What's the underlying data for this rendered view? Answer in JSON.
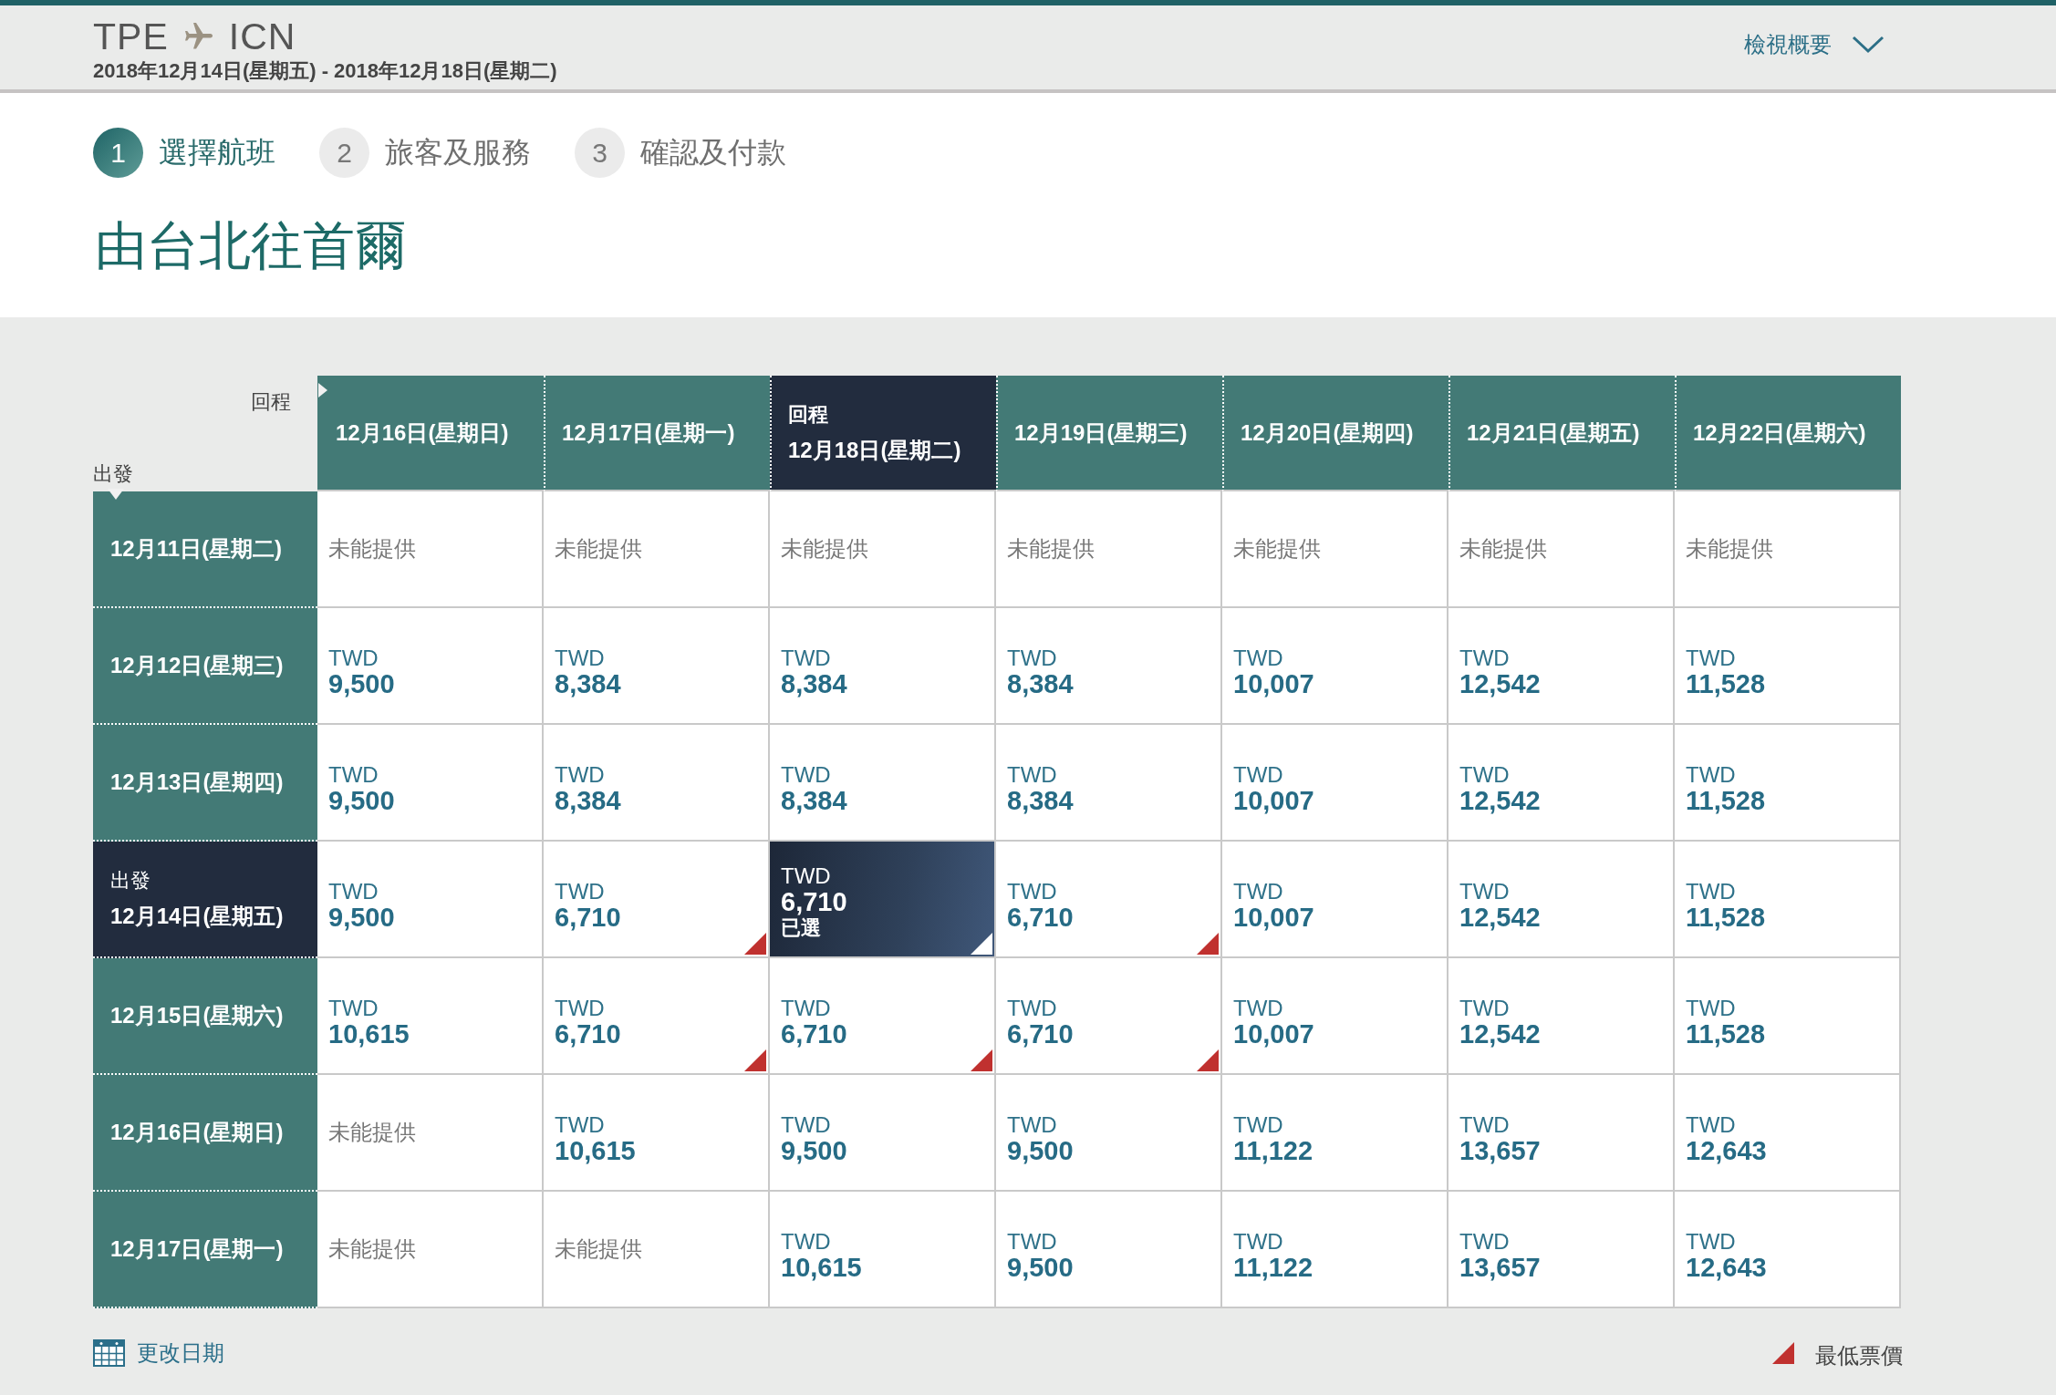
{
  "header": {
    "origin": "TPE",
    "destination": "ICN",
    "dates": "2018年12月14日(星期五) - 2018年12月18日(星期二)",
    "summary_link": "檢視概要"
  },
  "steps": [
    {
      "number": "1",
      "label": "選擇航班",
      "selected": true
    },
    {
      "number": "2",
      "label": "旅客及服務",
      "selected": false
    },
    {
      "number": "3",
      "label": "確認及付款",
      "selected": false
    }
  ],
  "title": "由台北往首爾",
  "fare_grid": {
    "return_label": "回程",
    "depart_label": "出發",
    "columns": [
      {
        "date": "12月16日(星期日)",
        "selected": false
      },
      {
        "date": "12月17日(星期一)",
        "selected": false
      },
      {
        "tag": "回程",
        "date": "12月18日(星期二)",
        "selected": true
      },
      {
        "date": "12月19日(星期三)",
        "selected": false
      },
      {
        "date": "12月20日(星期四)",
        "selected": false
      },
      {
        "date": "12月21日(星期五)",
        "selected": false
      },
      {
        "date": "12月22日(星期六)",
        "selected": false
      }
    ],
    "rows": [
      {
        "date": "12月11日(星期二)",
        "selected": false,
        "cells": [
          {
            "kind": "unavailable",
            "text": "未能提供",
            "selected": false,
            "lowest": false
          },
          {
            "kind": "unavailable",
            "text": "未能提供",
            "selected": false,
            "lowest": false
          },
          {
            "kind": "unavailable",
            "text": "未能提供",
            "selected": false,
            "lowest": false
          },
          {
            "kind": "unavailable",
            "text": "未能提供",
            "selected": false,
            "lowest": false
          },
          {
            "kind": "unavailable",
            "text": "未能提供",
            "selected": false,
            "lowest": false
          },
          {
            "kind": "unavailable",
            "text": "未能提供",
            "selected": false,
            "lowest": false
          },
          {
            "kind": "unavailable",
            "text": "未能提供",
            "selected": false,
            "lowest": false
          }
        ]
      },
      {
        "date": "12月12日(星期三)",
        "selected": false,
        "cells": [
          {
            "kind": "fare",
            "currency": "TWD",
            "amount": "9,500",
            "selected": false,
            "lowest": false
          },
          {
            "kind": "fare",
            "currency": "TWD",
            "amount": "8,384",
            "selected": false,
            "lowest": false
          },
          {
            "kind": "fare",
            "currency": "TWD",
            "amount": "8,384",
            "selected": false,
            "lowest": false
          },
          {
            "kind": "fare",
            "currency": "TWD",
            "amount": "8,384",
            "selected": false,
            "lowest": false
          },
          {
            "kind": "fare",
            "currency": "TWD",
            "amount": "10,007",
            "selected": false,
            "lowest": false
          },
          {
            "kind": "fare",
            "currency": "TWD",
            "amount": "12,542",
            "selected": false,
            "lowest": false
          },
          {
            "kind": "fare",
            "currency": "TWD",
            "amount": "11,528",
            "selected": false,
            "lowest": false
          }
        ]
      },
      {
        "date": "12月13日(星期四)",
        "selected": false,
        "cells": [
          {
            "kind": "fare",
            "currency": "TWD",
            "amount": "9,500",
            "selected": false,
            "lowest": false
          },
          {
            "kind": "fare",
            "currency": "TWD",
            "amount": "8,384",
            "selected": false,
            "lowest": false
          },
          {
            "kind": "fare",
            "currency": "TWD",
            "amount": "8,384",
            "selected": false,
            "lowest": false
          },
          {
            "kind": "fare",
            "currency": "TWD",
            "amount": "8,384",
            "selected": false,
            "lowest": false
          },
          {
            "kind": "fare",
            "currency": "TWD",
            "amount": "10,007",
            "selected": false,
            "lowest": false
          },
          {
            "kind": "fare",
            "currency": "TWD",
            "amount": "12,542",
            "selected": false,
            "lowest": false
          },
          {
            "kind": "fare",
            "currency": "TWD",
            "amount": "11,528",
            "selected": false,
            "lowest": false
          }
        ]
      },
      {
        "tag": "出發",
        "date": "12月14日(星期五)",
        "selected": true,
        "cells": [
          {
            "kind": "fare",
            "currency": "TWD",
            "amount": "9,500",
            "selected": false,
            "lowest": false
          },
          {
            "kind": "fare",
            "currency": "TWD",
            "amount": "6,710",
            "selected": false,
            "lowest": true
          },
          {
            "kind": "fare",
            "currency": "TWD",
            "amount": "6,710",
            "note": "已選",
            "selected": true,
            "lowest": true
          },
          {
            "kind": "fare",
            "currency": "TWD",
            "amount": "6,710",
            "selected": false,
            "lowest": true
          },
          {
            "kind": "fare",
            "currency": "TWD",
            "amount": "10,007",
            "selected": false,
            "lowest": false
          },
          {
            "kind": "fare",
            "currency": "TWD",
            "amount": "12,542",
            "selected": false,
            "lowest": false
          },
          {
            "kind": "fare",
            "currency": "TWD",
            "amount": "11,528",
            "selected": false,
            "lowest": false
          }
        ]
      },
      {
        "date": "12月15日(星期六)",
        "selected": false,
        "cells": [
          {
            "kind": "fare",
            "currency": "TWD",
            "amount": "10,615",
            "selected": false,
            "lowest": false
          },
          {
            "kind": "fare",
            "currency": "TWD",
            "amount": "6,710",
            "selected": false,
            "lowest": true
          },
          {
            "kind": "fare",
            "currency": "TWD",
            "amount": "6,710",
            "selected": false,
            "lowest": true
          },
          {
            "kind": "fare",
            "currency": "TWD",
            "amount": "6,710",
            "selected": false,
            "lowest": true
          },
          {
            "kind": "fare",
            "currency": "TWD",
            "amount": "10,007",
            "selected": false,
            "lowest": false
          },
          {
            "kind": "fare",
            "currency": "TWD",
            "amount": "12,542",
            "selected": false,
            "lowest": false
          },
          {
            "kind": "fare",
            "currency": "TWD",
            "amount": "11,528",
            "selected": false,
            "lowest": false
          }
        ]
      },
      {
        "date": "12月16日(星期日)",
        "selected": false,
        "cells": [
          {
            "kind": "unavailable",
            "text": "未能提供",
            "selected": false,
            "lowest": false
          },
          {
            "kind": "fare",
            "currency": "TWD",
            "amount": "10,615",
            "selected": false,
            "lowest": false
          },
          {
            "kind": "fare",
            "currency": "TWD",
            "amount": "9,500",
            "selected": false,
            "lowest": false
          },
          {
            "kind": "fare",
            "currency": "TWD",
            "amount": "9,500",
            "selected": false,
            "lowest": false
          },
          {
            "kind": "fare",
            "currency": "TWD",
            "amount": "11,122",
            "selected": false,
            "lowest": false
          },
          {
            "kind": "fare",
            "currency": "TWD",
            "amount": "13,657",
            "selected": false,
            "lowest": false
          },
          {
            "kind": "fare",
            "currency": "TWD",
            "amount": "12,643",
            "selected": false,
            "lowest": false
          }
        ]
      },
      {
        "date": "12月17日(星期一)",
        "selected": false,
        "cells": [
          {
            "kind": "unavailable",
            "text": "未能提供",
            "selected": false,
            "lowest": false
          },
          {
            "kind": "unavailable",
            "text": "未能提供",
            "selected": false,
            "lowest": false
          },
          {
            "kind": "fare",
            "currency": "TWD",
            "amount": "10,615",
            "selected": false,
            "lowest": false
          },
          {
            "kind": "fare",
            "currency": "TWD",
            "amount": "9,500",
            "selected": false,
            "lowest": false
          },
          {
            "kind": "fare",
            "currency": "TWD",
            "amount": "11,122",
            "selected": false,
            "lowest": false
          },
          {
            "kind": "fare",
            "currency": "TWD",
            "amount": "13,657",
            "selected": false,
            "lowest": false
          },
          {
            "kind": "fare",
            "currency": "TWD",
            "amount": "12,643",
            "selected": false,
            "lowest": false
          }
        ]
      }
    ]
  },
  "footer": {
    "change_dates": "更改日期",
    "legend": "最低票價"
  }
}
